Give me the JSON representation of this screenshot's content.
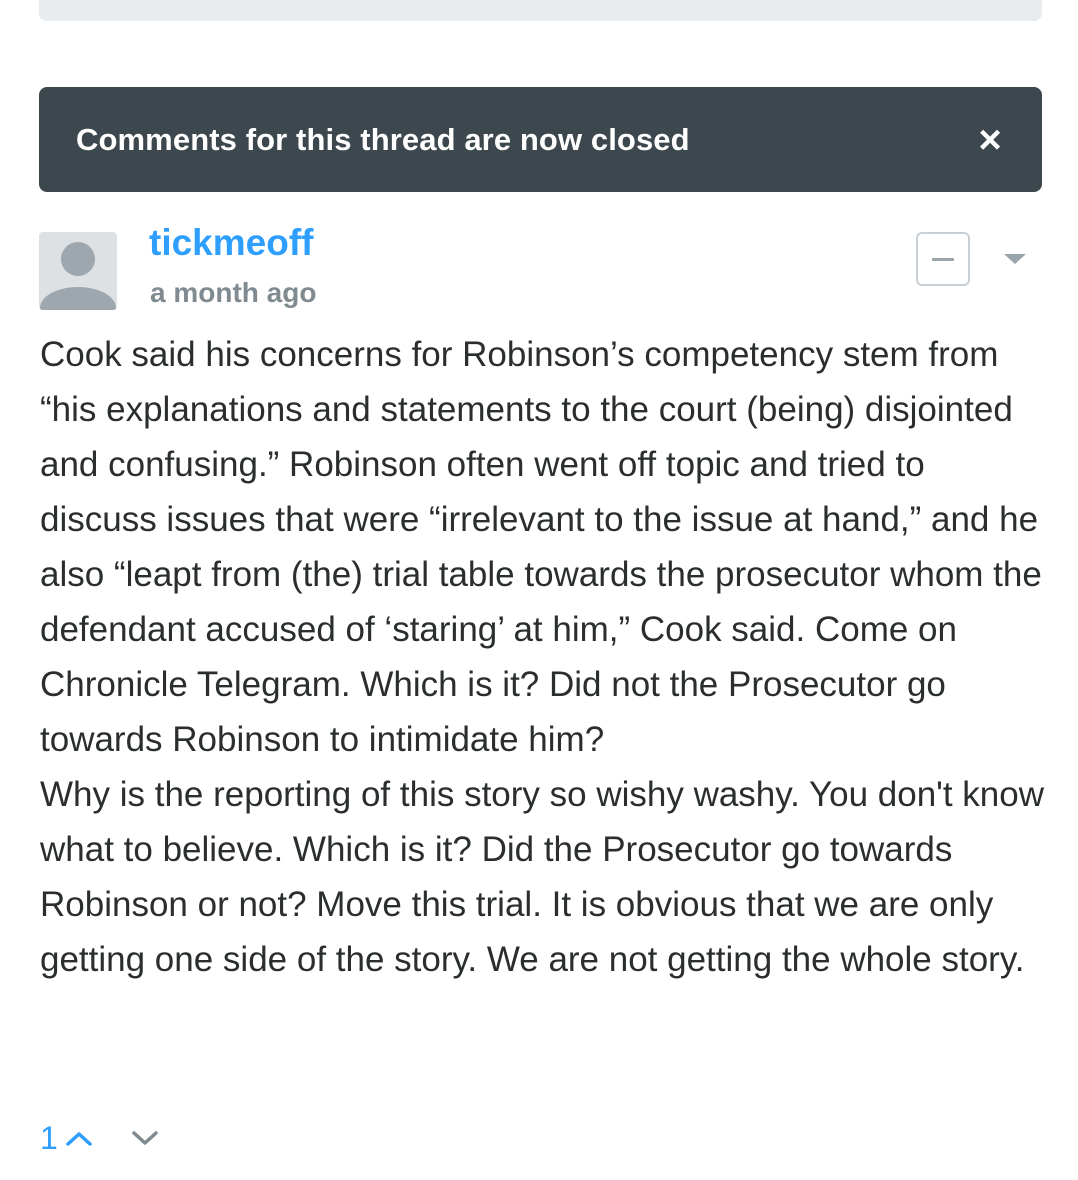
{
  "banner": {
    "text": "Comments for this thread are now closed",
    "close_icon": "×"
  },
  "comment": {
    "author": "tickmeoff",
    "timestamp": "a month ago",
    "paragraphs": [
      "Cook said his concerns for Robinson’s competency stem from “his explanations and statements to the court (being) disjointed and confusing.” Robinson often went off topic and tried to discuss issues that were “irrelevant to the issue at hand,” and he also “leapt from (the) trial table towards the prosecutor whom the defendant accused of ‘staring’ at him,” Cook said. Come on Chronicle Telegram. Which is it? Did not the Prosecutor go towards Robinson to intimidate him?",
      "Why is the reporting of this story so wishy washy. You don't know what to believe. Which is it? Did the Prosecutor go towards Robinson or not? Move this trial. It is obvious that we are only getting one side of the story. We are not getting the whole story."
    ],
    "votes": "1"
  },
  "icons": {
    "avatar": "default-avatar-icon",
    "collapse": "minus-icon",
    "menu": "caret-down-icon",
    "upvote": "chevron-up-icon",
    "downvote": "chevron-down-icon",
    "close": "close-icon"
  },
  "colors": {
    "banner_bg": "#3c474e",
    "author": "#2e9fff",
    "text": "#2a2e2e",
    "muted": "#7f8a91"
  }
}
